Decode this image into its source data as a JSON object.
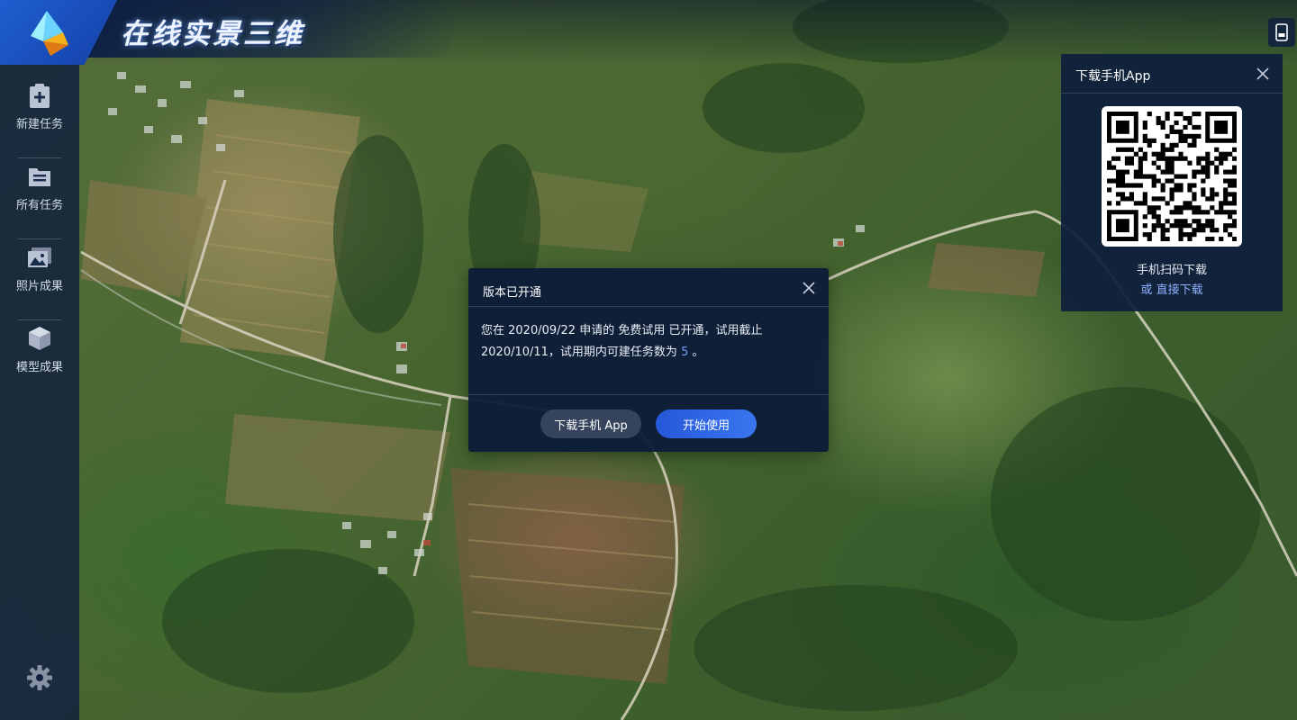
{
  "header": {
    "app_title": "在线实景三维"
  },
  "sidebar": {
    "items": [
      {
        "label": "新建任务",
        "icon": "clipboard-plus-icon"
      },
      {
        "label": "所有任务",
        "icon": "task-list-icon"
      },
      {
        "label": "照片成果",
        "icon": "photo-gallery-icon"
      },
      {
        "label": "模型成果",
        "icon": "cube-model-icon"
      }
    ],
    "settings_icon": "gear-icon"
  },
  "download_panel": {
    "title": "下载手机App",
    "scan_text": "手机扫码下载",
    "or_text": "或",
    "direct_link": "直接下载"
  },
  "modal": {
    "title": "版本已开通",
    "body_prefix": "您在 2020/09/22 申请的 免费试用 已开通，试用截止 2020/10/11，试用期内可建任务数为",
    "task_count": "5",
    "body_suffix": "。",
    "download_button": "下载手机 App",
    "start_button": "开始使用"
  },
  "colors": {
    "accent": "#2f6ae6",
    "link": "#8fb1ff",
    "panel_bg": "#0e1e3c"
  }
}
